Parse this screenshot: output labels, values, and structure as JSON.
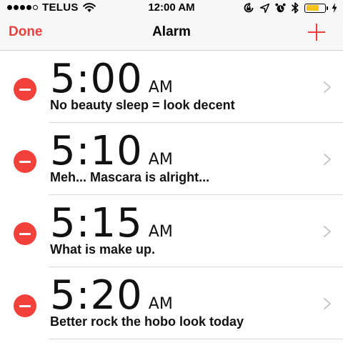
{
  "status_bar": {
    "carrier": "TELUS",
    "time": "12:00 AM",
    "signal_bars_filled": 4,
    "signal_bars_total": 5,
    "battery_level": 0.7,
    "battery_color": "#f4c21d",
    "icons": [
      "wifi-icon",
      "rotation-lock-icon",
      "location-icon",
      "alarm-icon",
      "bluetooth-icon",
      "battery-icon",
      "charging-icon"
    ]
  },
  "nav": {
    "done_label": "Done",
    "title": "Alarm",
    "add_icon": "plus-icon",
    "accent_color": "#e8413c"
  },
  "alarms": [
    {
      "time": "5:00",
      "ampm": "AM",
      "label": "No beauty sleep = look decent"
    },
    {
      "time": "5:10",
      "ampm": "AM",
      "label": "Meh... Mascara is alright..."
    },
    {
      "time": "5:15",
      "ampm": "AM",
      "label": "What is make up."
    },
    {
      "time": "5:20",
      "ampm": "AM",
      "label": "Better rock the hobo look today"
    }
  ],
  "colors": {
    "delete": "#f2403b",
    "chevron": "#c7c7cc"
  }
}
